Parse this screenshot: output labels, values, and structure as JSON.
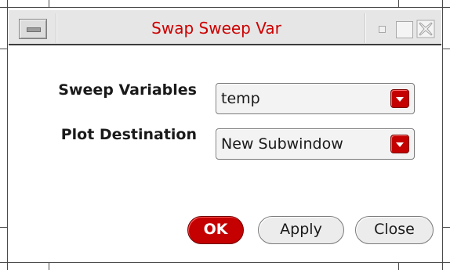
{
  "window": {
    "title": "Swap Sweep Var"
  },
  "form": {
    "sweep_variables": {
      "label": "Sweep Variables",
      "value": "temp"
    },
    "plot_destination": {
      "label": "Plot Destination",
      "value": "New Subwindow"
    }
  },
  "buttons": {
    "ok": "OK",
    "apply": "Apply",
    "close": "Close"
  },
  "icons": {
    "window_menu": "window-menu-icon",
    "minimize": "minimize-icon",
    "maximize": "maximize-icon",
    "close": "close-x-icon",
    "dropdown": "dropdown-arrow-icon"
  },
  "colors": {
    "title_text": "#cc0000",
    "accent": "#c40000",
    "titlebar_bg": "#e6e6e6",
    "window_bg": "#ffffff"
  }
}
